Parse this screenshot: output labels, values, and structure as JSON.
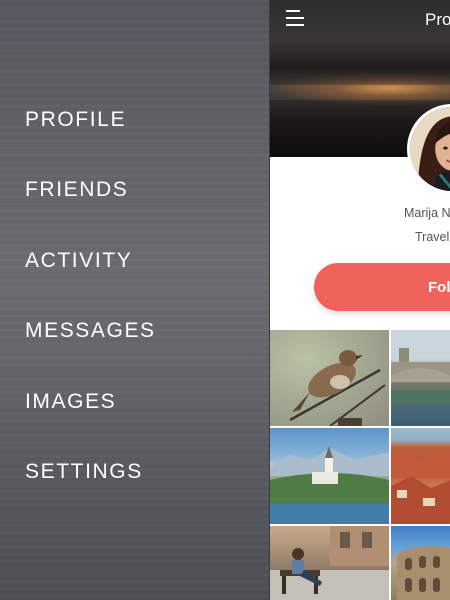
{
  "menu": {
    "items": [
      {
        "label": "PROFILE"
      },
      {
        "label": "FRIENDS"
      },
      {
        "label": "ACTIVITY"
      },
      {
        "label": "MESSAGES"
      },
      {
        "label": "IMAGES"
      },
      {
        "label": "SETTINGS"
      }
    ]
  },
  "header": {
    "title": "Pro",
    "menu_icon": "hamburger-menu-icon"
  },
  "profile": {
    "name": "Marija N",
    "role": "Travel",
    "follow_label": "Fol"
  },
  "gallery": {
    "images": [
      {
        "subject": "sparrow on branch"
      },
      {
        "subject": "old bridge town"
      },
      {
        "subject": "lake island church"
      },
      {
        "subject": "red roof city"
      },
      {
        "subject": "woman on bench"
      },
      {
        "subject": "colosseum"
      }
    ]
  },
  "colors": {
    "accent": "#f0635c",
    "menu_text": "#ffffff",
    "panel_bg": "#ffffff",
    "body_text": "#555555"
  }
}
